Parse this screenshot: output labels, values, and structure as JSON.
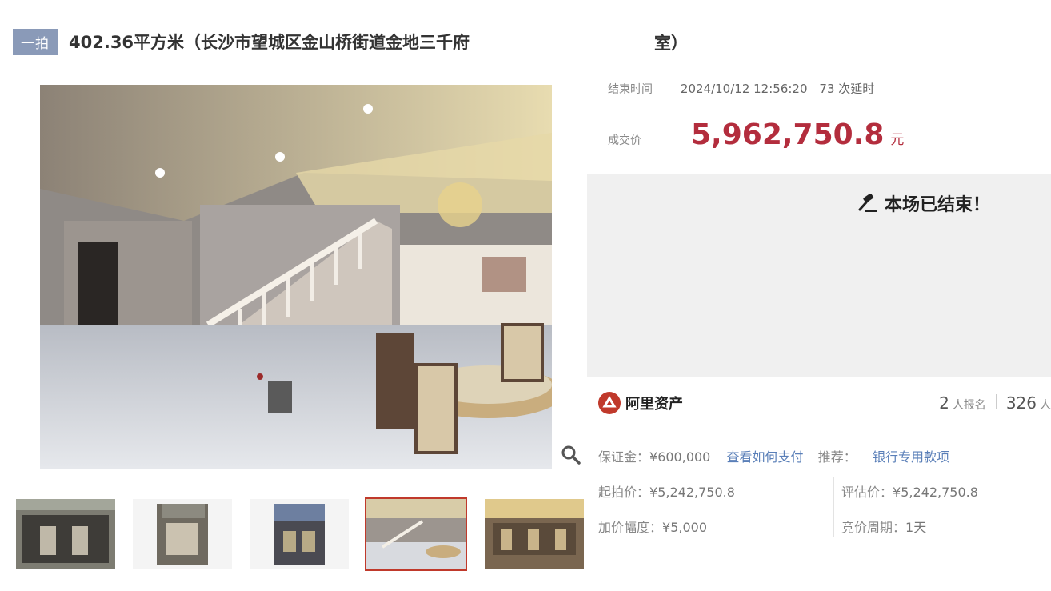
{
  "header": {
    "badge": "一拍",
    "title": "402.36平方米（长沙市望城区金山桥街道金地三千府",
    "title_end": "室）"
  },
  "auction": {
    "end_time_label": "结束时间",
    "end_time_value": "2024/10/12 12:56:20",
    "delays": "73 次延时",
    "price_label": "成交价",
    "price_value": "5,962,750.8",
    "price_unit": "元",
    "status": "本场已结束！"
  },
  "brand": {
    "name": "阿里资产",
    "signups_count": "2",
    "signups_label": "人报名",
    "watchers_count": "326",
    "watchers_label": "人"
  },
  "details": {
    "deposit_label": "保证金：",
    "deposit_value": "¥600,000",
    "how_to_pay": "查看如何支付",
    "recommend_label": "推荐：",
    "recommend_value": "银行专用款项",
    "start_price_label": "起拍价：",
    "start_price_value": "¥5,242,750.8",
    "appraisal_label": "评估价：",
    "appraisal_value": "¥5,242,750.8",
    "increment_label": "加价幅度：",
    "increment_value": "¥5,000",
    "cycle_label": "竞价周期：",
    "cycle_value": "1天"
  },
  "icons": {
    "zoom": "magnifier-icon",
    "status": "gavel-icon",
    "brand": "ali-asset-logo"
  },
  "colors": {
    "price": "#b32d3d",
    "badge": "#8a9ab8",
    "link": "#5a7fb8",
    "thumb_active": "#c0392b"
  }
}
